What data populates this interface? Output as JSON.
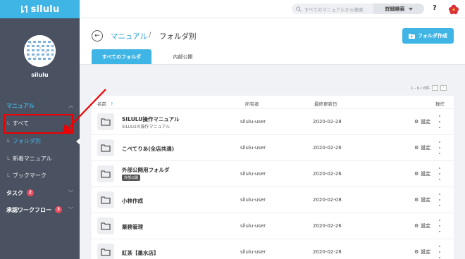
{
  "app": {
    "logo_text": "silulu"
  },
  "topbar": {
    "search_placeholder": "すべてのマニュアルから検索",
    "advanced_search_label": "詳細検索",
    "help_label": "?"
  },
  "sidebar": {
    "user_name": "silulu",
    "groups": [
      {
        "label": "マニュアル",
        "badge": "",
        "items": [
          {
            "label": "すべて"
          },
          {
            "label": "フォルダ別"
          },
          {
            "label": "新着マニュアル"
          },
          {
            "label": "ブックマーク"
          }
        ]
      },
      {
        "label": "タスク",
        "badge": "2",
        "items": []
      },
      {
        "label": "承認ワークフロー",
        "badge": "3",
        "items": []
      }
    ],
    "sub_mark": "L"
  },
  "page": {
    "breadcrumb_link": "マニュアル",
    "breadcrumb_sep": "/",
    "breadcrumb_current": "フォルダ別",
    "create_button": "フォルダ作成",
    "tabs": [
      {
        "label": "すべてのフォルダ",
        "active": true
      },
      {
        "label": "内部公開",
        "active": false
      }
    ],
    "pagination_text": "1 - 6 / 6件"
  },
  "table": {
    "headers": {
      "name": "名前",
      "owner": "所有者",
      "updated": "最終更新日",
      "action": "操作"
    },
    "sort_indicator": "↑",
    "settings_label": "設定",
    "rows": [
      {
        "name": "SILULU操作マニュアル",
        "sub": "SILULUの操作マニュアル",
        "tag": "",
        "owner": "silulu-user",
        "date": "2020-02-28"
      },
      {
        "name": "こぺてりあ(全店共通)",
        "sub": "",
        "tag": "",
        "owner": "silulu-user",
        "date": "2020-02-26"
      },
      {
        "name": "外部公開用フォルダ",
        "sub": "",
        "tag": "外部公開",
        "owner": "silulu-user",
        "date": "2020-02-26"
      },
      {
        "name": "小林作成",
        "sub": "",
        "tag": "",
        "owner": "silulu-user",
        "date": "2020-02-08"
      },
      {
        "name": "業務管理",
        "sub": "",
        "tag": "",
        "owner": "silulu-user",
        "date": "2020-02-26"
      },
      {
        "name": "紅茶【墨水店】",
        "sub": "",
        "tag": "",
        "owner": "silulu-user",
        "date": "2020-02-28"
      }
    ]
  },
  "colors": {
    "accent": "#3fb5e5",
    "sidebar_bg": "#4a5261",
    "sidebar_active": "#3fb5e5",
    "badge": "#e84a5f",
    "annotation": "#ee0000"
  }
}
